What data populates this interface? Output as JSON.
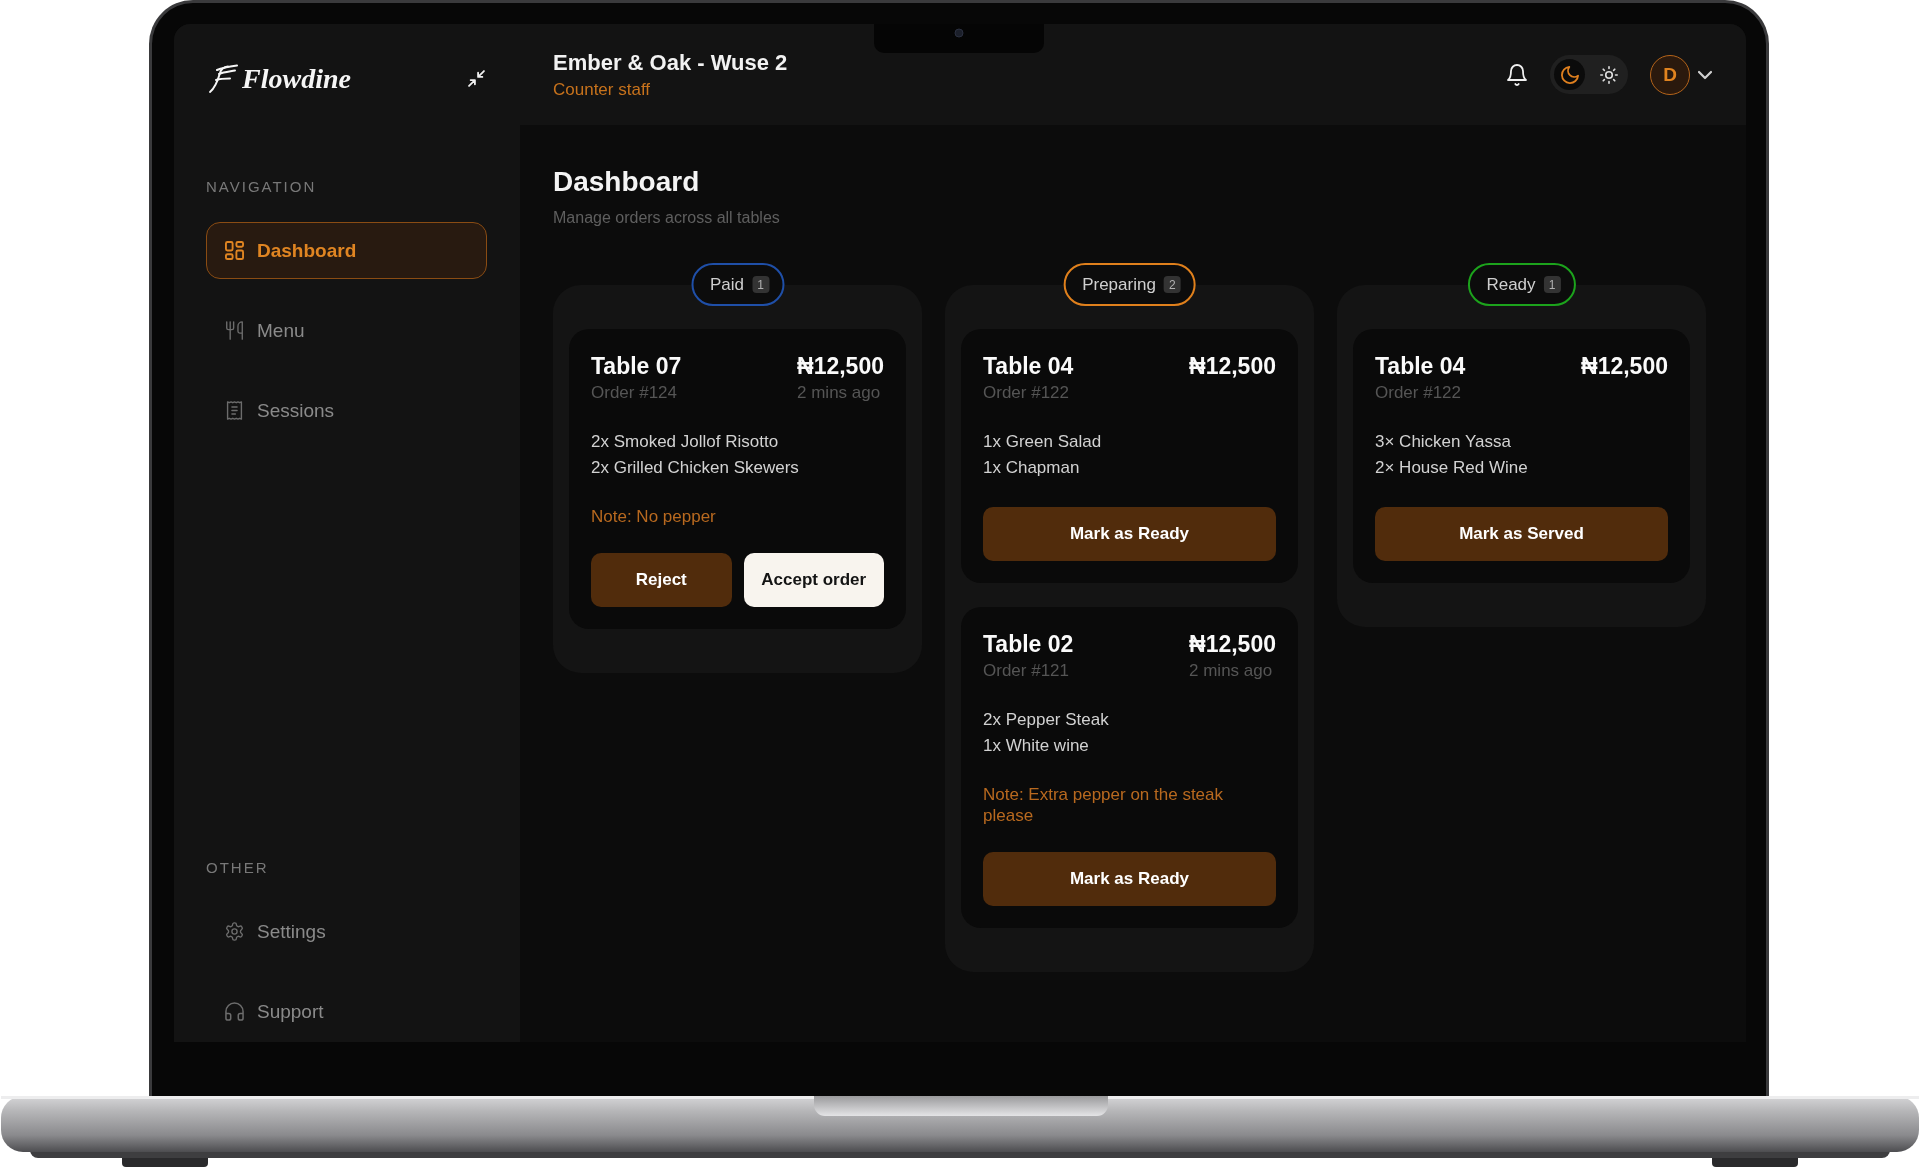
{
  "sidebar": {
    "brand": "Flowdine",
    "sections": [
      {
        "title": "NAVIGATION",
        "items": [
          {
            "kind": "dashboard",
            "label": "Dashboard",
            "selected": true
          },
          {
            "kind": "menu",
            "label": "Menu",
            "selected": false
          },
          {
            "kind": "sessions",
            "label": "Sessions",
            "selected": false
          }
        ]
      },
      {
        "title": "OTHER",
        "items": [
          {
            "kind": "settings",
            "label": "Settings",
            "selected": false
          },
          {
            "kind": "support",
            "label": "Support",
            "selected": false
          }
        ]
      }
    ]
  },
  "header": {
    "title": "Ember & Oak - Wuse 2",
    "subtitle": "Counter staff",
    "theme_options": [
      {
        "kind": "moon",
        "selected": true
      },
      {
        "kind": "sun",
        "selected": false
      }
    ],
    "avatar": "D"
  },
  "page": {
    "title": "Dashboard",
    "subtitle": "Manage orders across all tables"
  },
  "columns": [
    {
      "status": "Paid",
      "count": "1",
      "color": "#1f4fa8",
      "orders": [
        {
          "table": "Table 07",
          "total": "₦12,500",
          "order": "Order #124",
          "time": "2 mins ago",
          "items": [
            "2x Smoked Jollof Risotto",
            "2x Grilled Chicken Skewers"
          ],
          "note": "Note: No pepper",
          "actions": [
            {
              "kind": "reject",
              "label": "Reject"
            },
            {
              "kind": "accept",
              "label": "Accept order"
            }
          ]
        }
      ]
    },
    {
      "status": "Preparing",
      "count": "2",
      "color": "#e0801c",
      "orders": [
        {
          "table": "Table 04",
          "total": "₦12,500",
          "order": "Order #122",
          "items": [
            "1x Green Salad",
            "1x Chapman"
          ],
          "actions": [
            {
              "kind": "ready",
              "label": "Mark as Ready"
            }
          ]
        },
        {
          "table": "Table 02",
          "total": "₦12,500",
          "order": "Order #121",
          "time": "2 mins ago",
          "items": [
            "2x Pepper Steak",
            "1x White wine"
          ],
          "note": "Note: Extra pepper on the steak please",
          "actions": [
            {
              "kind": "ready",
              "label": "Mark as Ready"
            }
          ]
        }
      ]
    },
    {
      "status": "Ready",
      "count": "1",
      "color": "#1ca31c",
      "orders": [
        {
          "table": "Table 04",
          "total": "₦12,500",
          "order": "Order #122",
          "items": [
            "3× Chicken Yassa",
            "2× House Red Wine"
          ],
          "actions": [
            {
              "kind": "serve",
              "label": "Mark as Served"
            }
          ]
        }
      ]
    }
  ]
}
